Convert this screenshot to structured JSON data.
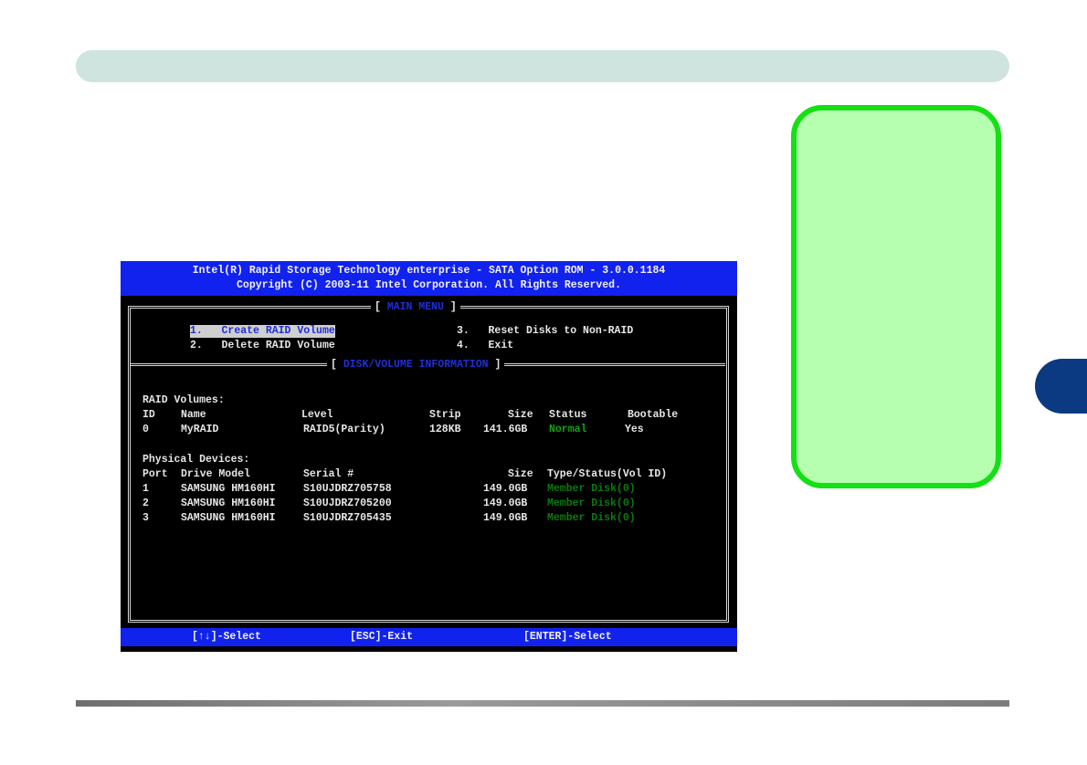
{
  "bios": {
    "title_line1": "Intel(R) Rapid Storage Technology enterprise - SATA Option ROM - 3.0.0.1184",
    "title_line2": "Copyright (C) 2003-11 Intel Corporation. All Rights Reserved.",
    "main_menu": {
      "title": "MAIN MENU",
      "items": [
        {
          "num": "1.",
          "label": "Create RAID Volume"
        },
        {
          "num": "2.",
          "label": "Delete RAID Volume"
        },
        {
          "num": "3.",
          "label": "Reset Disks to Non-RAID"
        },
        {
          "num": "4.",
          "label": "Exit"
        }
      ]
    },
    "info": {
      "title": "DISK/VOLUME INFORMATION",
      "raid_volumes_label": "RAID Volumes:",
      "volume_headers": [
        "ID",
        "Name",
        "Level",
        "Strip",
        "Size",
        "Status",
        "Bootable"
      ],
      "volumes": [
        {
          "id": "0",
          "name": "MyRAID",
          "level": "RAID5(Parity)",
          "strip": "128KB",
          "size": "141.6GB",
          "status": "Normal",
          "bootable": "Yes"
        }
      ],
      "physical_label": "Physical Devices:",
      "device_headers": [
        "Port",
        "Drive Model",
        "Serial #",
        "Size",
        "Type/Status(Vol ID)"
      ],
      "devices": [
        {
          "port": "1",
          "model": "SAMSUNG HM160HI",
          "serial": "S10UJDRZ705758",
          "size": "149.0GB",
          "status": "Member Disk(0)"
        },
        {
          "port": "2",
          "model": "SAMSUNG HM160HI",
          "serial": "S10UJDRZ705200",
          "size": "149.0GB",
          "status": "Member Disk(0)"
        },
        {
          "port": "3",
          "model": "SAMSUNG HM160HI",
          "serial": "S10UJDRZ705435",
          "size": "149.0GB",
          "status": "Member Disk(0)"
        }
      ]
    },
    "footer": {
      "select": "[↑↓]-Select",
      "exit": "[ESC]-Exit",
      "enter": "[ENTER]-Select"
    }
  }
}
